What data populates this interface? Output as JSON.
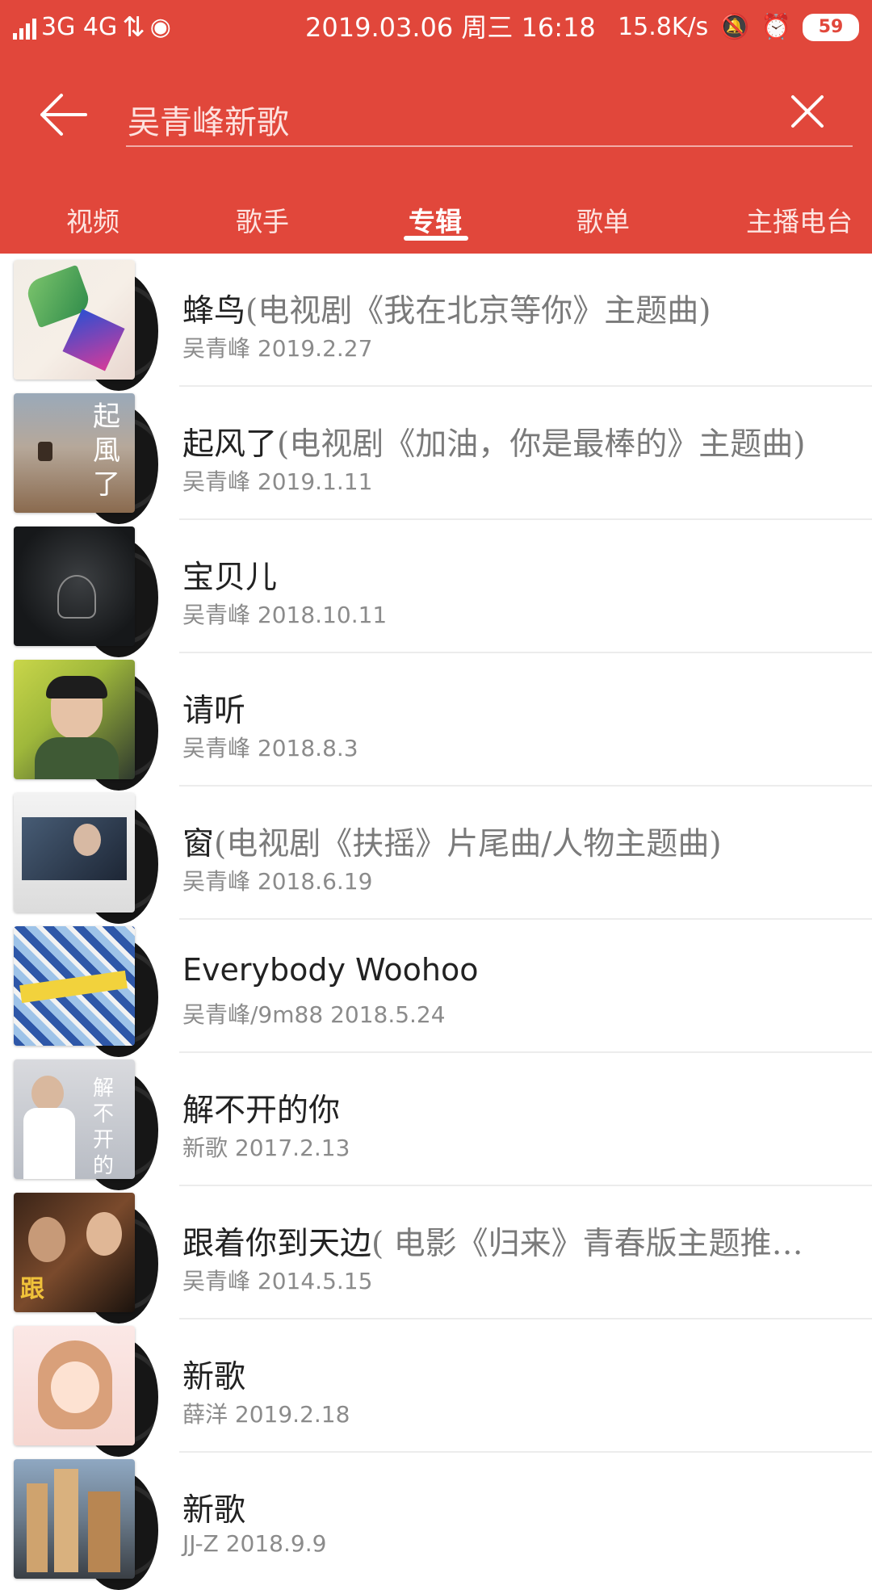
{
  "status_bar": {
    "network": "3G 4G",
    "datetime": "2019.03.06 周三 16:18",
    "speed": "15.8K/s",
    "battery": "59"
  },
  "search": {
    "query": "吴青峰新歌"
  },
  "tabs": [
    "视频",
    "歌手",
    "专辑",
    "歌单",
    "主播电台"
  ],
  "active_tab": "专辑",
  "albums": [
    {
      "title": "蜂鸟",
      "subtitle": "(电视剧《我在北京等你》主题曲)",
      "artist": "吴青峰",
      "date": "2019.2.27"
    },
    {
      "title": "起风了",
      "subtitle": "(电视剧《加油，你是最棒的》主题曲)",
      "artist": "吴青峰",
      "date": "2019.1.11"
    },
    {
      "title": "宝贝儿",
      "subtitle": "",
      "artist": "吴青峰",
      "date": "2018.10.11"
    },
    {
      "title": "请听",
      "subtitle": "",
      "artist": "吴青峰",
      "date": "2018.8.3"
    },
    {
      "title": "窗",
      "subtitle": "(电视剧《扶摇》片尾曲/人物主题曲)",
      "artist": "吴青峰",
      "date": "2018.6.19"
    },
    {
      "title": "Everybody Woohoo",
      "subtitle": "",
      "artist": "吴青峰/9m88",
      "date": "2018.5.24"
    },
    {
      "title": "解不开的你",
      "subtitle": "",
      "artist": "新歌",
      "date": "2017.2.13"
    },
    {
      "title": "跟着你到天边",
      "subtitle": "( 电影《归来》青春版主题推…",
      "artist": "吴青峰",
      "date": "2014.5.15"
    },
    {
      "title": "新歌",
      "subtitle": "",
      "artist": "薛洋",
      "date": "2019.2.18"
    },
    {
      "title": "新歌",
      "subtitle": "",
      "artist": "JJ-Z",
      "date": "2018.9.9"
    }
  ]
}
